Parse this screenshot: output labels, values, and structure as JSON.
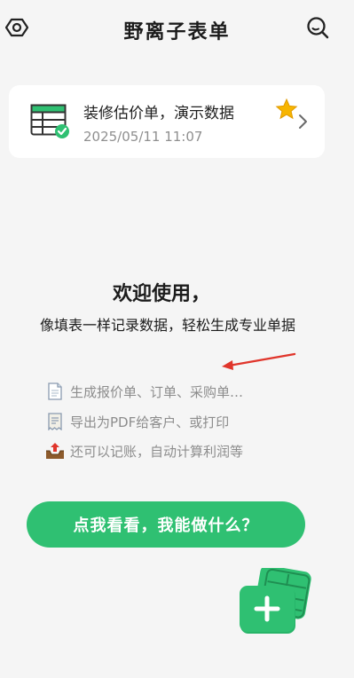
{
  "header": {
    "title": "野离子表单",
    "left_icon": "settings-icon",
    "right_icon": "search-icon"
  },
  "card": {
    "title": "装修估价单，演示数据",
    "date": "2025/05/11 11:07",
    "icons": [
      "spreadsheet-check-icon",
      "star-icon",
      "chevron-right-icon"
    ]
  },
  "welcome": {
    "heading": "欢迎使用，",
    "description": "像填表一样记录数据，轻松生成专业单据"
  },
  "features": [
    {
      "icon": "document-icon",
      "text": "生成报价单、订单、采购单…"
    },
    {
      "icon": "receipt-icon",
      "text": "导出为PDF给客户、或打印"
    },
    {
      "icon": "outbox-tray-icon",
      "text": "还可以记账，自动计算利润等"
    }
  ],
  "cta_button": {
    "label": "点我看看，我能做什么？"
  },
  "fab": {
    "icon": "add-sheet-icon"
  },
  "colors": {
    "accent": "#2fc072",
    "arrow": "#e0352b",
    "background": "#f5f5f5",
    "star": "#f7b500"
  }
}
